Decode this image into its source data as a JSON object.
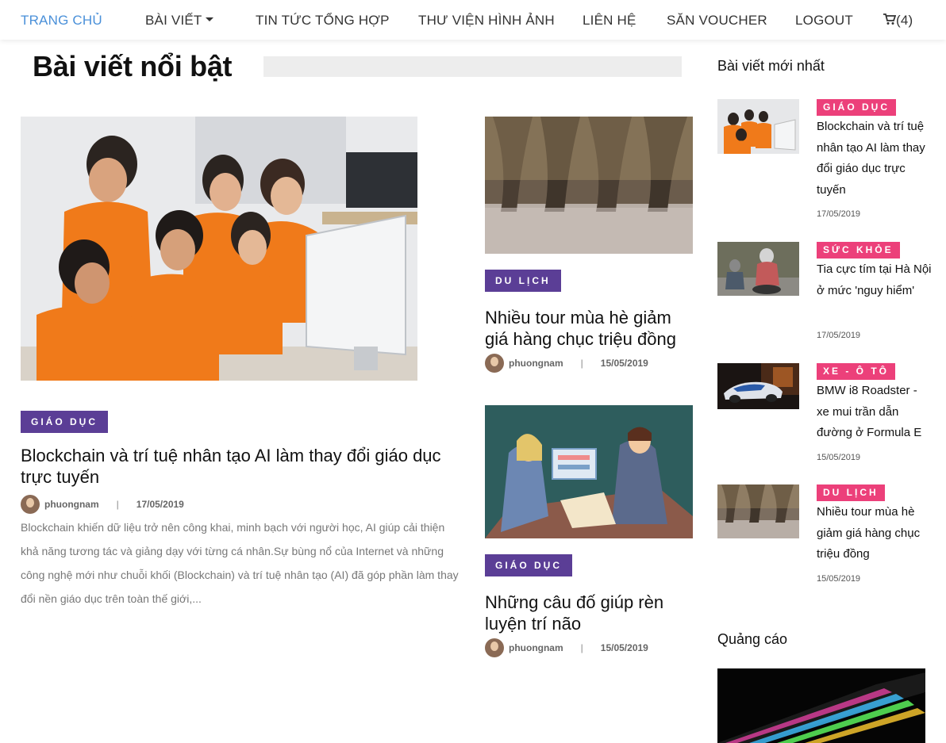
{
  "nav": {
    "home": "TRANG CHỦ",
    "posts": "BÀI VIẾT",
    "news": "TIN TỨC TỔNG HỢP",
    "gallery": "THƯ VIỆN HÌNH ẢNH",
    "contact": "LIÊN HỆ",
    "voucher": "SĂN VOUCHER",
    "logout": "LOGOUT",
    "cart_count": "(4)",
    "active_color": "#4a90d9"
  },
  "featured": {
    "heading": "Bài viết nổi bật",
    "main": {
      "category": "GIÁO DỤC",
      "title": "Blockchain và trí tuệ nhân tạo AI làm thay đổi giáo dục trực tuyến",
      "author": "phuongnam",
      "separator": "|",
      "date": "17/05/2019",
      "excerpt": "Blockchain khiến dữ liệu trở nên công khai, minh bạch với người học, AI giúp cải thiện khả năng tương tác và giảng dạy với từng cá nhân.Sự bùng nổ của Internet và những công nghệ mới như chuỗi khối (Blockchain) và trí tuệ nhân tạo (AI) đã góp phần làm thay đổi nền giáo dục trên toàn thế giới,..."
    },
    "side1": {
      "category": "DU LỊCH",
      "title": "Nhiều tour mùa hè giảm giá hàng chục triệu đồng",
      "author": "phuongnam",
      "separator": "|",
      "date": "15/05/2019"
    },
    "side2": {
      "category": "GIÁO DỤC",
      "title": "Những câu đố giúp rèn luyện trí não",
      "author": "phuongnam",
      "separator": "|",
      "date": "15/05/2019"
    }
  },
  "sidebar": {
    "latest_heading": "Bài viết mới nhất",
    "items": [
      {
        "category": "GIÁO DỤC",
        "title": "Blockchain và trí tuệ nhân tạo AI làm thay đổi giáo dục trực tuyến",
        "date": "17/05/2019"
      },
      {
        "category": "SỨC KHỎE",
        "title": "Tia cực tím tại Hà Nội ở mức 'nguy hiểm'",
        "date": "17/05/2019"
      },
      {
        "category": "XE - Ô TÔ",
        "title": "BMW i8 Roadster - xe mui trần dẫn đường ở Formula E",
        "date": "15/05/2019"
      },
      {
        "category": "DU LỊCH",
        "title": "Nhiều tour mùa hè giảm giá hàng chục triệu đồng",
        "date": "15/05/2019"
      }
    ],
    "ads_heading": "Quảng cáo"
  },
  "colors": {
    "tag_purple": "#5b3e96",
    "tag_pink": "#ec407a"
  }
}
